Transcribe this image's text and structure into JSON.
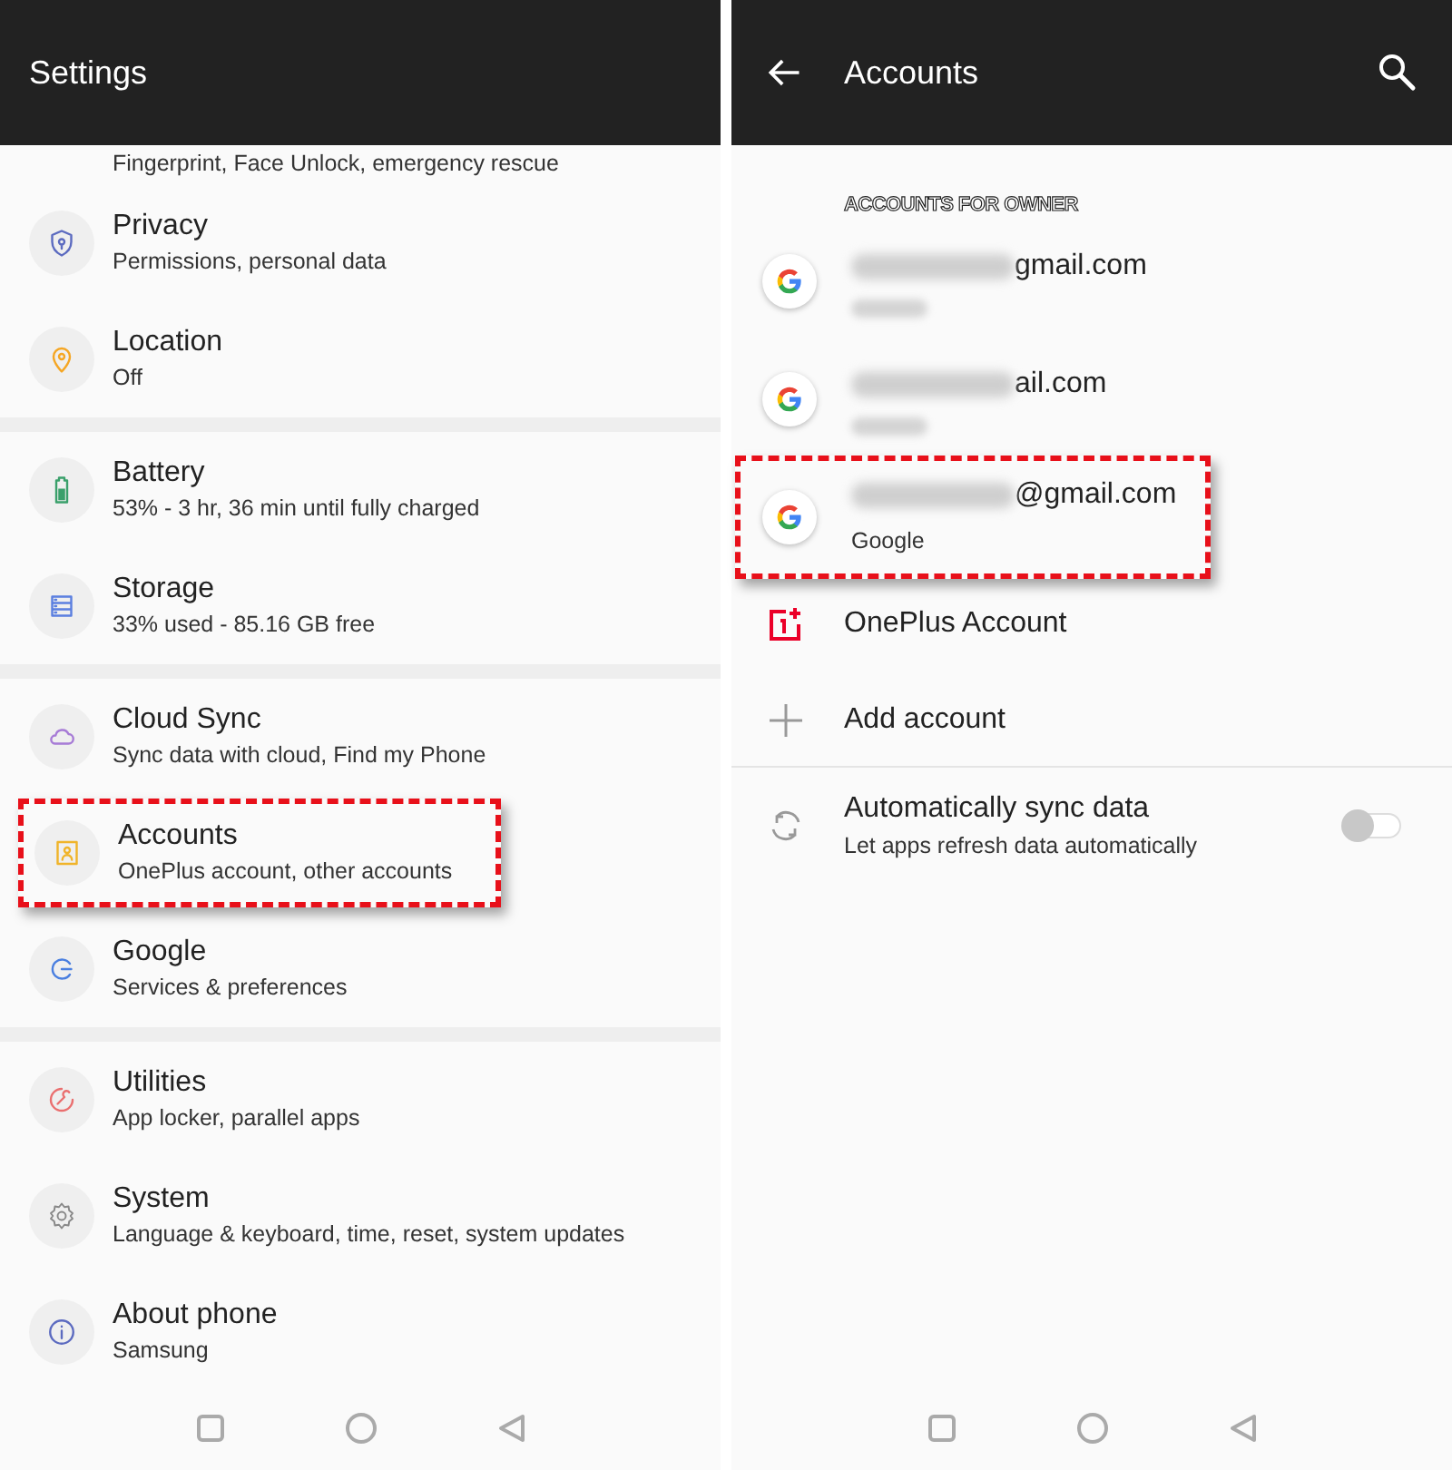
{
  "settings": {
    "title": "Settings",
    "sections": [
      [
        {
          "kind": "partial",
          "subtitle": "Fingerprint, Face Unlock, emergency rescue"
        },
        {
          "kind": "full",
          "title": "Privacy",
          "subtitle": "Permissions, personal data",
          "highlighted": false
        },
        {
          "kind": "full",
          "title": "Location",
          "subtitle": "Off",
          "highlighted": false
        }
      ],
      [
        {
          "kind": "full",
          "title": "Battery",
          "subtitle": "53% - 3 hr, 36 min until fully charged",
          "highlighted": false
        },
        {
          "kind": "full",
          "title": "Storage",
          "subtitle": "33% used - 85.16 GB free",
          "highlighted": false
        }
      ],
      [
        {
          "kind": "full",
          "title": "Cloud Sync",
          "subtitle": "Sync data with cloud, Find my Phone",
          "highlighted": false
        },
        {
          "kind": "full",
          "title": "Accounts",
          "subtitle": "OnePlus account, other accounts",
          "highlighted": true
        },
        {
          "kind": "full",
          "title": "Google",
          "subtitle": "Services & preferences",
          "highlighted": false
        }
      ],
      [
        {
          "kind": "full",
          "title": "Utilities",
          "subtitle": "App locker, parallel apps",
          "highlighted": false
        },
        {
          "kind": "full",
          "title": "System",
          "subtitle": "Language & keyboard, time, reset, system updates",
          "highlighted": false
        },
        {
          "kind": "full",
          "title": "About phone",
          "subtitle": "Samsung",
          "highlighted": false
        }
      ]
    ]
  },
  "accounts": {
    "title": "Accounts",
    "section_header": "ACCOUNTS FOR OWNER",
    "items": [
      {
        "email_visible": "gmail.com",
        "subtitle_redacted": true,
        "highlighted": false
      },
      {
        "email_visible": "ail.com",
        "subtitle_redacted": true,
        "highlighted": false
      },
      {
        "email_visible": "@gmail.com",
        "provider": "Google",
        "subtitle_redacted": false,
        "highlighted": true
      }
    ],
    "oneplus_account": "OnePlus Account",
    "add_account": "Add account",
    "sync": {
      "title": "Automatically sync data",
      "subtitle": "Let apps refresh data automatically",
      "on": false
    }
  }
}
